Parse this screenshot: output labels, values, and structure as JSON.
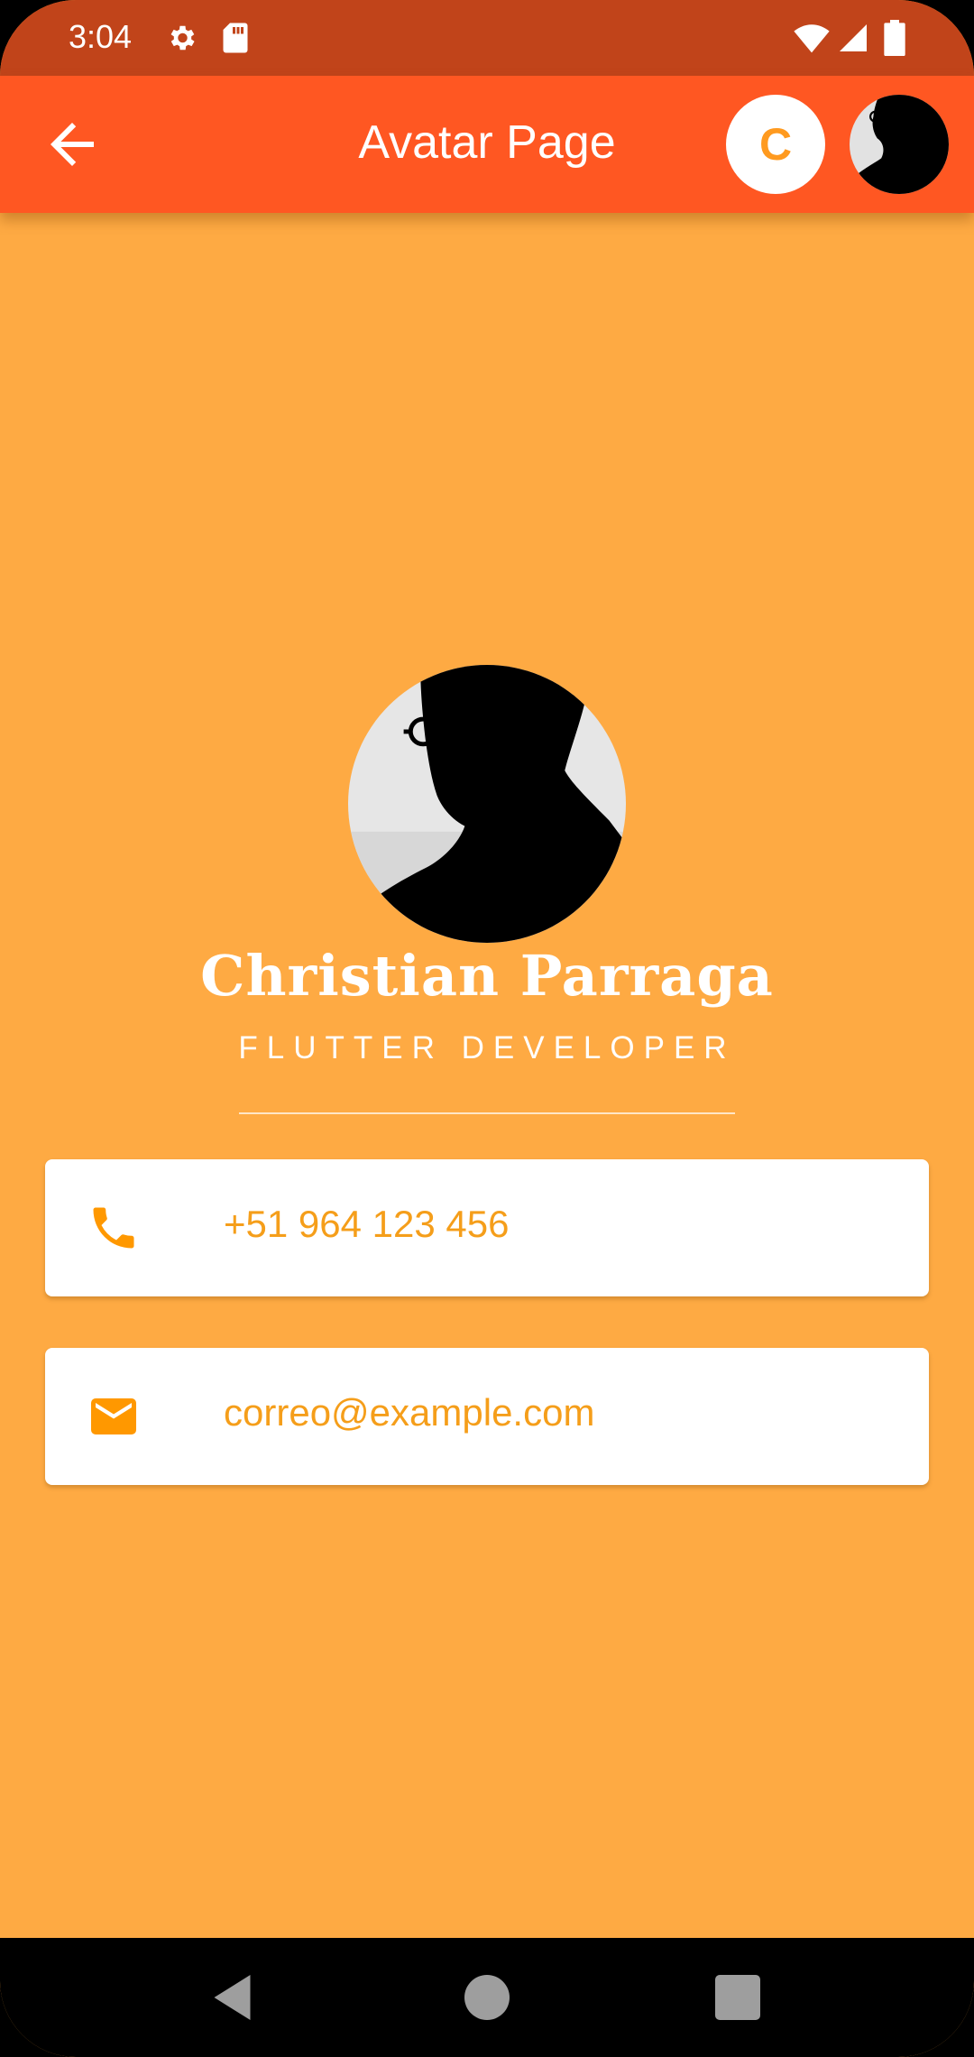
{
  "status_bar": {
    "time": "3:04",
    "icons": [
      "settings-icon",
      "sd-card-icon",
      "wifi-icon",
      "signal-icon",
      "battery-icon"
    ]
  },
  "app_bar": {
    "title": "Avatar Page",
    "avatar_letter": "C",
    "back_icon": "arrow-back-icon"
  },
  "profile": {
    "name": "Christian Parraga",
    "role": "FLUTTER DEVELOPER"
  },
  "contacts": [
    {
      "icon": "phone-icon",
      "text": "+51 964 123 456"
    },
    {
      "icon": "email-icon",
      "text": "correo@example.com"
    }
  ],
  "nav_bar": {
    "icons": [
      "back-triangle-icon",
      "home-circle-icon",
      "recents-square-icon"
    ]
  },
  "colors": {
    "background": "#FEAA43",
    "app_bar": "#FF5722",
    "status_bar": "#C1441A",
    "accent_text": "#F59E1A"
  }
}
